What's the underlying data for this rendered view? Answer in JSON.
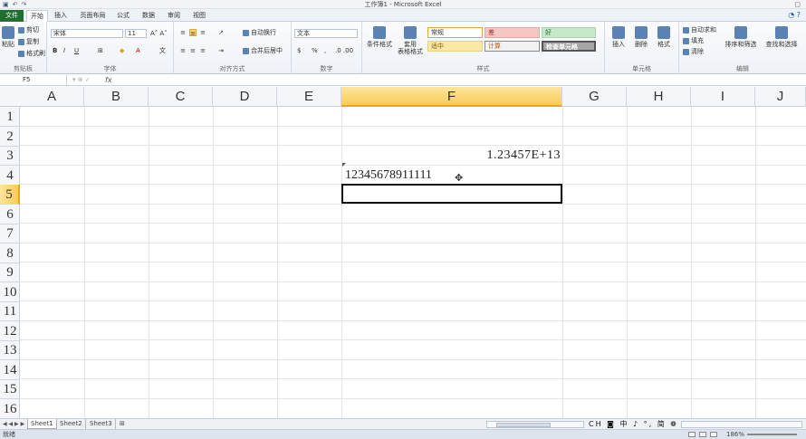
{
  "window": {
    "title": "工作簿1 - Microsoft Excel"
  },
  "tabs": {
    "file": "文件",
    "items": [
      "开始",
      "插入",
      "页面布局",
      "公式",
      "数据",
      "审阅",
      "视图"
    ]
  },
  "ribbon": {
    "clipboard": {
      "paste": "粘贴",
      "cut": "剪切",
      "copy": "复制",
      "format_painter": "格式刷",
      "label": "剪贴板"
    },
    "font": {
      "name": "宋体",
      "size": "11",
      "label": "字体"
    },
    "alignment": {
      "wrap": "自动换行",
      "merge": "合并后居中",
      "label": "对齐方式"
    },
    "number": {
      "format": "文本",
      "label": "数字"
    },
    "styles": {
      "cond_format": "条件格式",
      "table_format_1": "套用",
      "table_format_2": "表格格式",
      "normal": "常规",
      "bad": "差",
      "good": "好",
      "neutral": "适中",
      "calc": "计算",
      "check": "检查单元格",
      "label": "样式"
    },
    "cells": {
      "insert": "插入",
      "delete": "删除",
      "format": "格式",
      "label": "单元格"
    },
    "editing": {
      "autosum": "自动求和",
      "fill": "填充",
      "clear": "清除",
      "sort": "排序和筛选",
      "find": "查找和选择",
      "label": "编辑"
    }
  },
  "formula_bar": {
    "name_box": "F5",
    "fx": "fx"
  },
  "columns": [
    "A",
    "B",
    "C",
    "D",
    "E",
    "F",
    "G",
    "H",
    "I",
    "J"
  ],
  "rows": [
    "1",
    "2",
    "3",
    "4",
    "5",
    "6",
    "7",
    "8",
    "9",
    "10",
    "11",
    "12",
    "13",
    "14",
    "15",
    "16"
  ],
  "cells": {
    "F3": "1.23457E+13",
    "F4": "12345678911111"
  },
  "sheets": [
    "Sheet1",
    "Sheet2",
    "Sheet3"
  ],
  "ime": "CH ◙ 中 ♪ °, 简 ❁ ⁝",
  "status": {
    "ready": "就绪",
    "zoom": "186%"
  },
  "colors": {
    "file_tab": "#1f6f2e",
    "selection_header": "#f8cc5a",
    "bad_style": "#f7c6c4",
    "good_style": "#c6e9c9",
    "neutral_style": "#fbe8a6",
    "check_style": "#a6a6a6"
  }
}
